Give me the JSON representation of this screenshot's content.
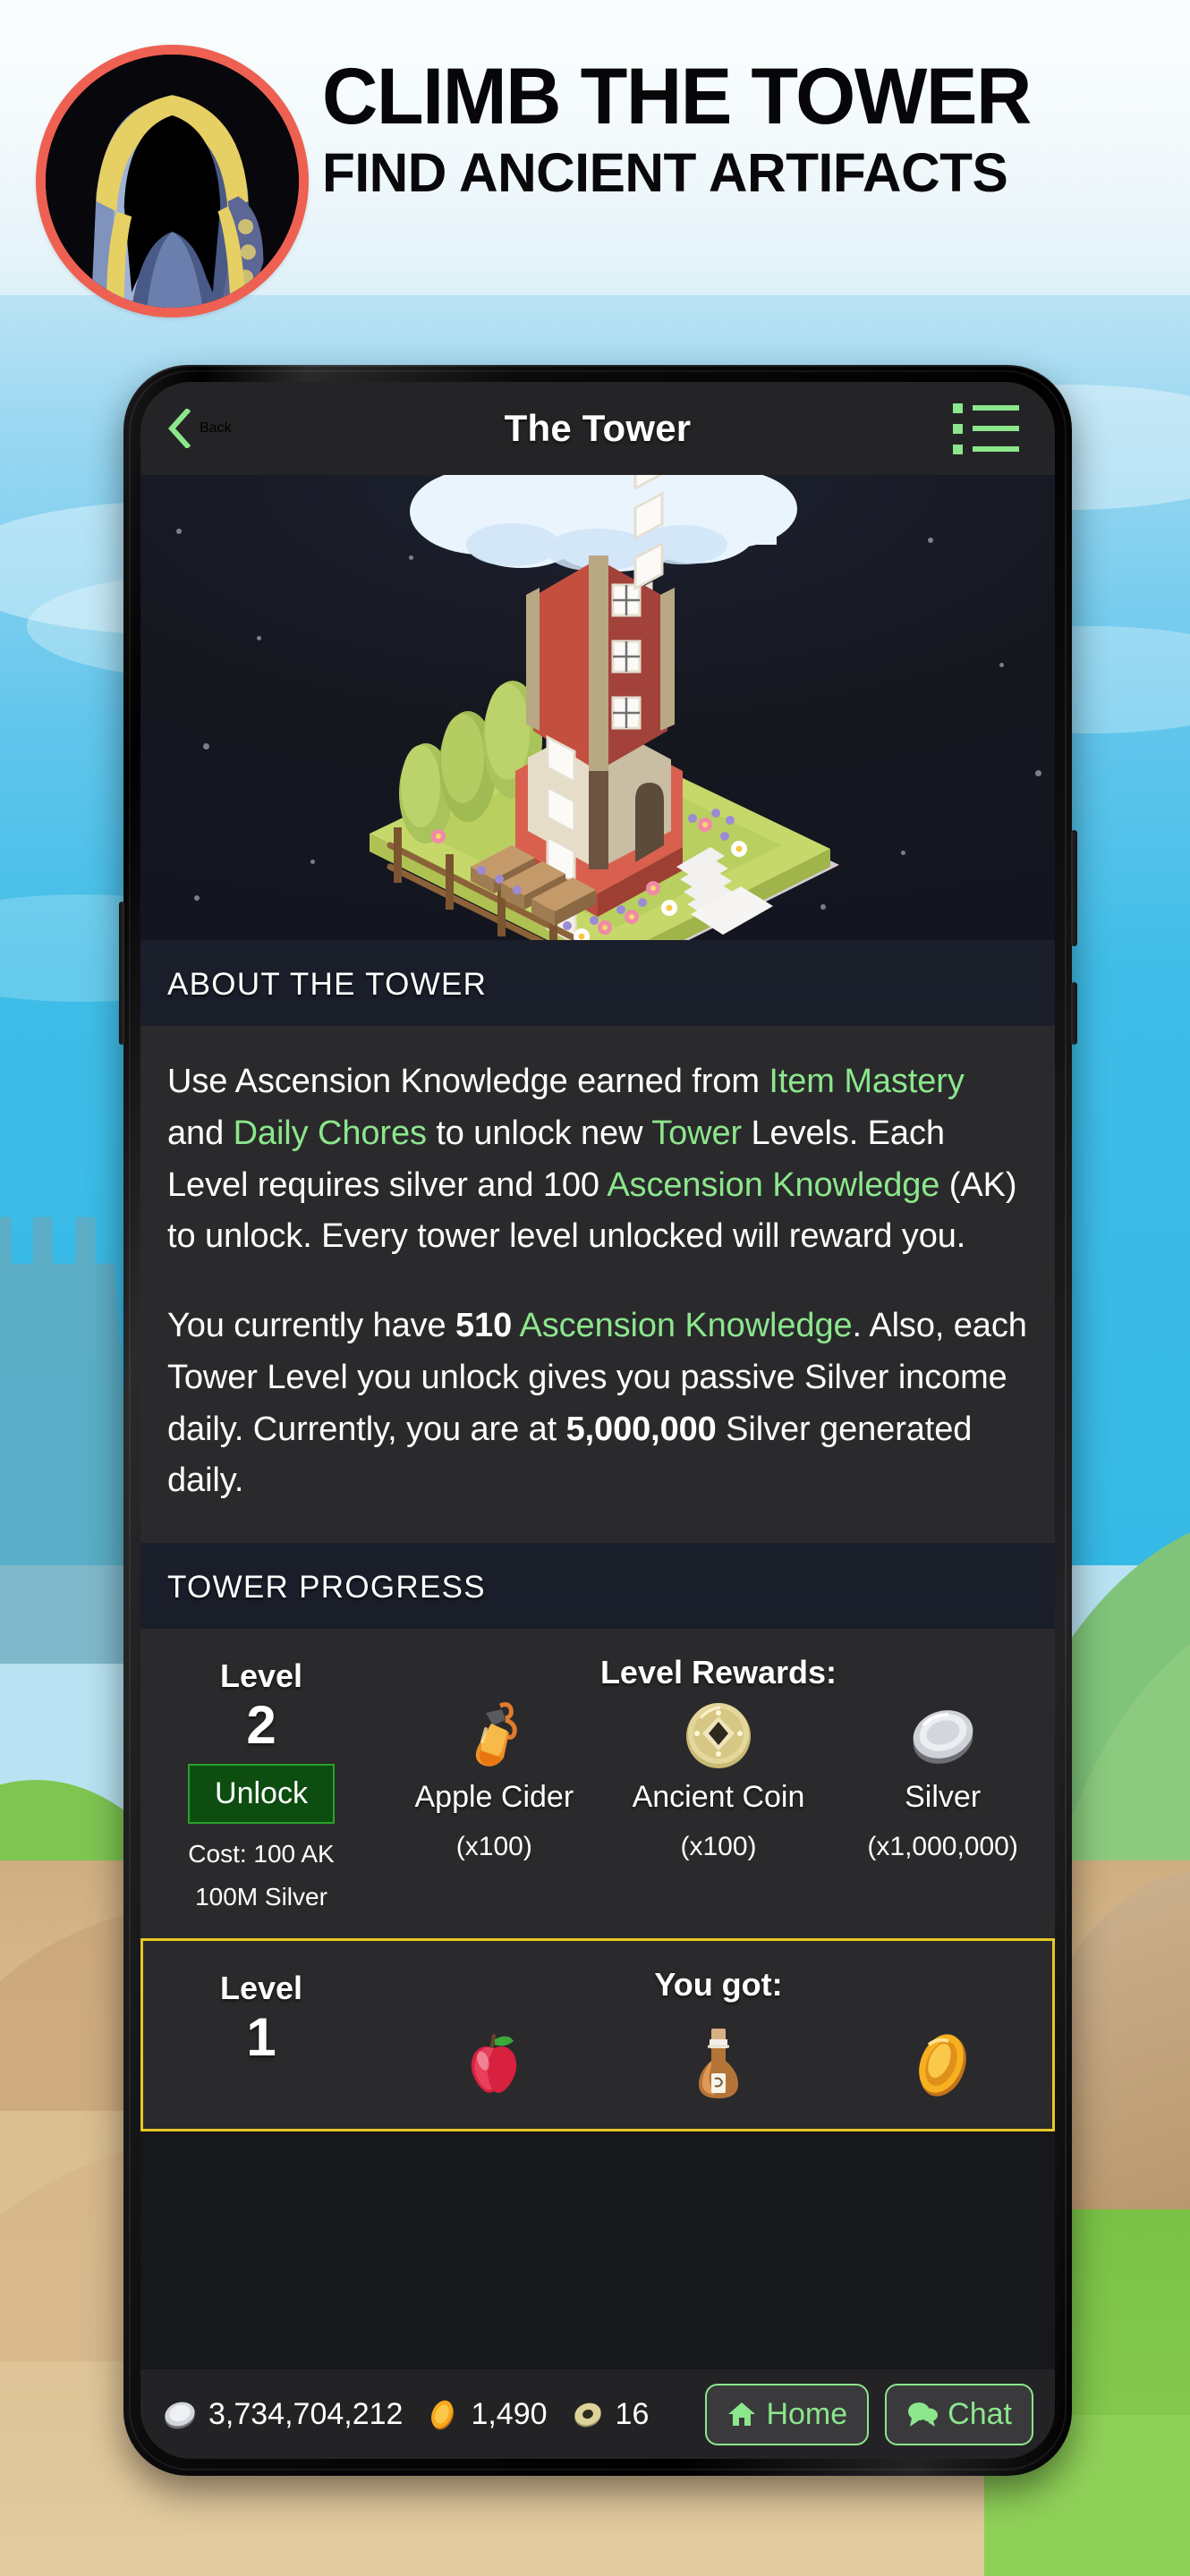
{
  "brand": {
    "title": "CLIMB THE TOWER",
    "subtitle": "FIND ANCIENT ARTIFACTS",
    "avatar_icon": "hooded-figure-avatar",
    "ring_color": "#ee6152"
  },
  "nav": {
    "back_label": "Back",
    "back_icon": "chevron-left-icon",
    "title": "The Tower",
    "menu_icon": "list-menu-icon",
    "accent_color": "#8ce68c"
  },
  "hero": {
    "illustration": "isometric-tower-illustration"
  },
  "about": {
    "section_title": "ABOUT THE TOWER",
    "paragraph1": {
      "p1": "Use Ascension Knowledge earned from ",
      "link1": "Item Mastery",
      "p2": " and ",
      "link2": "Daily Chores",
      "p3": " to unlock new ",
      "link3": "Tower",
      "p4": " Levels. Each Level requires silver and 100 ",
      "link4": "Ascension Knowledge",
      "p5": " (AK) to unlock. Every tower level unlocked will reward you."
    },
    "paragraph2": {
      "p1": "You currently have ",
      "bold1": "510",
      "p2": " ",
      "link1": "Ascension Knowledge",
      "p3": ". Also, each Tower Level you unlock gives you passive Silver income daily. Currently, you are at ",
      "bold2": "5,000,000",
      "p4": " Silver generated daily."
    }
  },
  "progress": {
    "section_title": "TOWER PROGRESS",
    "levels": [
      {
        "level_word": "Level",
        "level_number": "2",
        "unlock_label": "Unlock",
        "cost_ak": "Cost: 100 AK",
        "cost_silver": "100M Silver",
        "rewards_header": "Level Rewards:",
        "highlighted": false,
        "rewards": [
          {
            "icon": "apple-cider-bottle-icon",
            "name": "Apple Cider",
            "qty": "(x100)"
          },
          {
            "icon": "ancient-coin-icon",
            "name": "Ancient Coin",
            "qty": "(x100)"
          },
          {
            "icon": "silver-coin-icon",
            "name": "Silver",
            "qty": "(x1,000,000)"
          }
        ]
      },
      {
        "level_word": "Level",
        "level_number": "1",
        "rewards_header": "You got:",
        "highlighted": true,
        "rewards": [
          {
            "icon": "apple-icon",
            "name": "",
            "qty": ""
          },
          {
            "icon": "potion-bottle-icon",
            "name": "",
            "qty": ""
          },
          {
            "icon": "gold-coin-icon",
            "name": "",
            "qty": ""
          }
        ]
      }
    ]
  },
  "bottom_bar": {
    "currencies": [
      {
        "icon": "silver-coin-icon",
        "value": "3,734,704,212"
      },
      {
        "icon": "gold-coin-icon",
        "value": "1,490"
      },
      {
        "icon": "ancient-coin-icon",
        "value": "16"
      }
    ],
    "home_label": "Home",
    "home_icon": "home-icon",
    "chat_label": "Chat",
    "chat_icon": "chat-bubble-icon"
  }
}
